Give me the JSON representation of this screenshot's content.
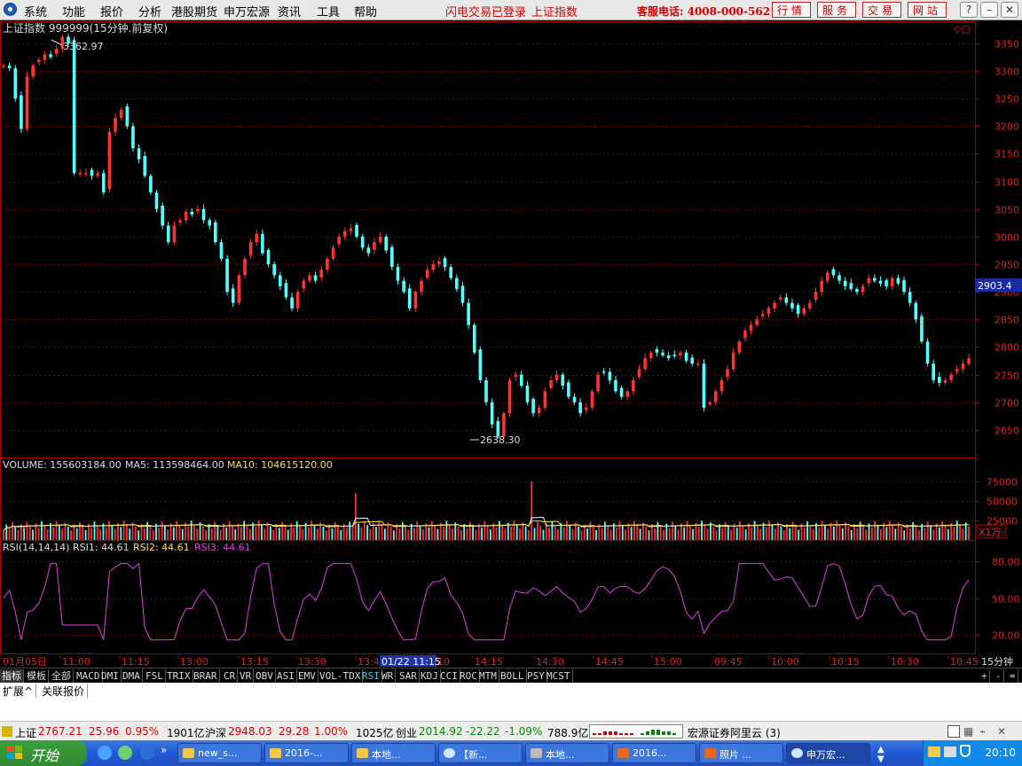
{
  "menu": {
    "items": [
      "系统",
      "功能",
      "报价",
      "分析",
      "港股期货",
      "申万宏源",
      "资讯",
      "工具",
      "帮助"
    ],
    "flash_login": "闪电交易已登录",
    "index_link": "上证指数",
    "hotline": "客服电话: 4008-000-562",
    "buttons": [
      "行情",
      "服务",
      "交易",
      "网站"
    ]
  },
  "main_chart": {
    "title": "上证指数 999999(15分钟.前复权)",
    "high_label": "3362.97",
    "low_label": "2638.30",
    "current_price": "2903.4",
    "y_ticks": [
      "3350",
      "3300",
      "3250",
      "3200",
      "3150",
      "3100",
      "3050",
      "3000",
      "2950",
      "2900",
      "2850",
      "2800",
      "2750",
      "2700",
      "2650"
    ]
  },
  "volume": {
    "label": "VOLUME: 155603184.00",
    "ma5": "MA5: 113598464.00",
    "ma10": "MA10: 104615120.00",
    "y_ticks": [
      "75000",
      "50000",
      "25000"
    ],
    "unit": "X1万"
  },
  "rsi": {
    "label": "RSI(14,14,14)",
    "rsi1": "RSI1: 44.61",
    "rsi2": "RSI2: 44.61",
    "rsi3": "RSI3: 44.61",
    "y_ticks": [
      "80.00",
      "50.00",
      "20.00"
    ]
  },
  "time_axis": {
    "labels": [
      "01月05日",
      "11:00",
      "11:15",
      "13:00",
      "13:15",
      "13:30",
      "13:4",
      "10",
      "14:15",
      "14:30",
      "14:45",
      "15:00",
      "09:45",
      "10:00",
      "10:15",
      "10:30",
      "10:45"
    ],
    "cursor": "01/22 11:15",
    "period": "15分钟"
  },
  "indicator_tabs": [
    "指标",
    "模板",
    "全部",
    "MACD",
    "DMI",
    "DMA",
    "FSL",
    "TRIX",
    "BRAR",
    "CR",
    "VR",
    "OBV",
    "ASI",
    "EMV",
    "VOL-TDX",
    "RSI",
    "WR",
    "SAR",
    "KDJ",
    "CCI",
    "ROC",
    "MTM",
    "BOLL",
    "PSY",
    "MCST"
  ],
  "extension_tabs": [
    "扩展^",
    "关联报价"
  ],
  "status": {
    "sh_label": "上证",
    "sh_value": "2767.21",
    "sh_change": "25.96",
    "sh_pct": "0.95%",
    "sh_amount": "1901亿",
    "hs_label": "沪深",
    "hs_value": "2948.03",
    "hs_change": "29.28",
    "hs_pct": "1.00%",
    "hs_amount": "1025亿",
    "cy_label": "创业",
    "cy_value": "2014.92",
    "cy_change": "-22.22",
    "cy_pct": "-1.09%",
    "cy_amount": "788.9亿",
    "server": "宏源证券阿里云 (3)"
  },
  "taskbar": {
    "start": "开始",
    "tasks": [
      "new_s...",
      "2016-...",
      "本地...",
      "【新...",
      "本地...",
      "2016...",
      "照片 ...",
      "申万宏..."
    ],
    "clock": "20:10"
  },
  "colors": {
    "up": "#ff3232",
    "down": "#54ffff",
    "grid": "#7a0000",
    "rsi": "#e040e0"
  },
  "chart_data": {
    "type": "candlestick",
    "title": "上证指数 999999(15分钟.前复权)",
    "y_range": [
      2600,
      3390
    ],
    "close_path": [
      3310,
      3305,
      3250,
      3195,
      3290,
      3310,
      3320,
      3330,
      3325,
      3340,
      3362,
      3350,
      3115,
      3115,
      3115,
      3110,
      3115,
      3080,
      3190,
      3215,
      3230,
      3200,
      3160,
      3140,
      3110,
      3080,
      3050,
      3020,
      2990,
      3020,
      3030,
      3045,
      3040,
      3050,
      3030,
      3020,
      2990,
      2960,
      2900,
      2880,
      2930,
      2960,
      2990,
      3005,
      2970,
      2950,
      2930,
      2910,
      2890,
      2870,
      2900,
      2920,
      2930,
      2920,
      2940,
      2960,
      2980,
      3000,
      3010,
      3015,
      3000,
      2980,
      2970,
      2990,
      3000,
      2975,
      2945,
      2920,
      2900,
      2870,
      2900,
      2920,
      2940,
      2950,
      2955,
      2945,
      2925,
      2905,
      2880,
      2840,
      2790,
      2740,
      2700,
      2660,
      2638,
      2680,
      2740,
      2750,
      2730,
      2700,
      2680,
      2690,
      2720,
      2740,
      2750,
      2730,
      2710,
      2700,
      2680,
      2690,
      2720,
      2750,
      2755,
      2740,
      2720,
      2710,
      2720,
      2740,
      2760,
      2780,
      2790,
      2790,
      2785,
      2780,
      2785,
      2790,
      2775,
      2770,
      2770,
      2690,
      2700,
      2720,
      2740,
      2760,
      2790,
      2810,
      2830,
      2840,
      2850,
      2860,
      2870,
      2880,
      2890,
      2880,
      2870,
      2860,
      2870,
      2880,
      2900,
      2920,
      2935,
      2930,
      2920,
      2910,
      2905,
      2900,
      2910,
      2925,
      2920,
      2915,
      2910,
      2925,
      2915,
      2900,
      2880,
      2850,
      2810,
      2770,
      2740,
      2735,
      2740,
      2750,
      2760,
      2770,
      2780
    ]
  }
}
